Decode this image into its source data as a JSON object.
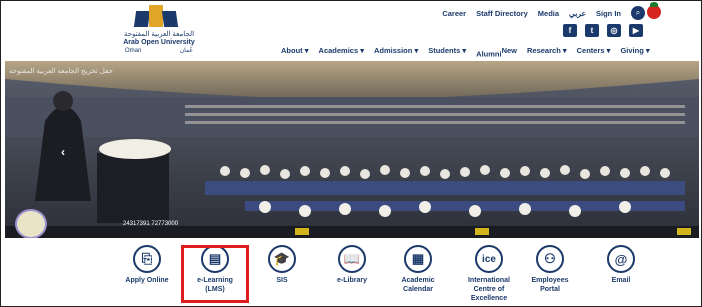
{
  "logo": {
    "arabic_name": "الجامعة العربية المفتوحة",
    "english_name": "Arab Open University",
    "country_en": "Oman",
    "country_ar": "عُمان"
  },
  "top_links": [
    "Career",
    "Staff Directory",
    "Media",
    "عربي",
    "Sign In"
  ],
  "icons": {
    "search": "search-icon",
    "flag": "oman-flag-icon",
    "social": [
      "facebook-icon",
      "twitter-icon",
      "instagram-icon",
      "youtube-icon"
    ]
  },
  "social_glyphs": [
    "f",
    "t",
    "◎",
    "▶"
  ],
  "nav": [
    {
      "label": "About",
      "caret": "▾"
    },
    {
      "label": "Academics",
      "caret": "▾"
    },
    {
      "label": "Admission",
      "caret": "▾"
    },
    {
      "label": "Students",
      "caret": "▾"
    },
    {
      "label": "Alumni",
      "badge": "New"
    },
    {
      "label": "Research",
      "caret": "▾"
    },
    {
      "label": "Centers",
      "caret": "▾"
    },
    {
      "label": "Giving",
      "caret": "▾"
    }
  ],
  "hero": {
    "caption": "حفل تخريج الجامعة العربية المفتوحة",
    "phone_text": "24317391  72773000",
    "prev_arrow": "‹"
  },
  "quick_links": [
    {
      "label": "Apply Online",
      "icon": "apply-online-icon",
      "glyph": "⎘"
    },
    {
      "label": "e-Learning\n(LMS)",
      "icon": "e-learning-icon",
      "glyph": "▤"
    },
    {
      "label": "SIS",
      "icon": "graduation-cap-icon",
      "glyph": "🎓"
    },
    {
      "label": "e-Library",
      "icon": "library-book-icon",
      "glyph": "📖"
    },
    {
      "label": "Academic\nCalendar",
      "icon": "calendar-icon",
      "glyph": "▦"
    },
    {
      "label": "International\nCentre of\nExcellence",
      "icon": "ice-icon",
      "glyph": "ice"
    },
    {
      "label": "Employees\nPortal",
      "icon": "employees-icon",
      "glyph": "⚇"
    },
    {
      "label": "Email",
      "icon": "email-at-icon",
      "glyph": "@"
    }
  ],
  "colors": {
    "brand": "#1b3a6b",
    "gold": "#e0a526",
    "highlight": "#e01d1d"
  }
}
